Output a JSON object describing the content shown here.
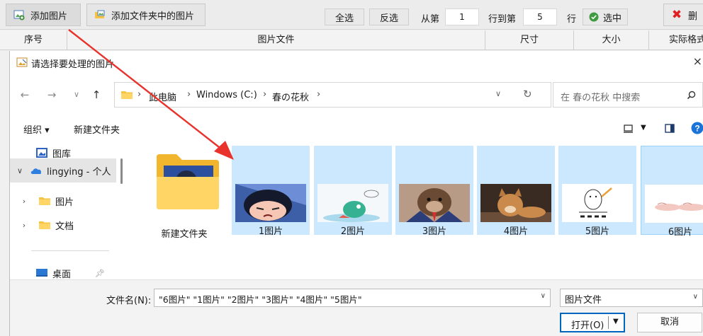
{
  "toolbar": {
    "add_image": "添加图片",
    "add_folder_images": "添加文件夹中的图片",
    "select_all": "全选",
    "invert": "反选",
    "from_label": "从第",
    "from_value": "1",
    "to_label": "行到第",
    "to_value": "5",
    "row_label": "行",
    "select_label": "选中",
    "delete_label": "删"
  },
  "table": {
    "columns": [
      "序号",
      "图片文件",
      "尺寸",
      "大小",
      "实际格式"
    ]
  },
  "dialog": {
    "title": "请选择要处理的图片",
    "close_glyph": "×",
    "breadcrumb": [
      "此电脑",
      "Windows (C:)",
      "春の花秋"
    ],
    "search_placeholder": "在 春の花秋 中搜索",
    "organize_label": "组织 ▾",
    "new_folder_cmd": "新建文件夹",
    "nav_items": [
      {
        "label": "图库"
      },
      {
        "label": "lingying - 个人"
      },
      {
        "label": "图片"
      },
      {
        "label": "文档"
      },
      {
        "label": "桌面"
      }
    ],
    "files": [
      {
        "label": "新建文件夹",
        "selected": false
      },
      {
        "label": "1图片",
        "selected": true
      },
      {
        "label": "2图片",
        "selected": true
      },
      {
        "label": "3图片",
        "selected": true
      },
      {
        "label": "4图片",
        "selected": true
      },
      {
        "label": "5图片",
        "selected": true
      },
      {
        "label": "6图片",
        "selected": true
      }
    ],
    "filename_label": "文件名(N):",
    "filename_value": "\"6图片\" \"1图片\" \"2图片\" \"3图片\" \"4图片\" \"5图片\"",
    "filetype_value": "图片文件",
    "open_label": "打开(O)",
    "cancel_label": "取消"
  },
  "colors": {
    "selection": "#cce8ff",
    "accent": "#0067c0",
    "folder": "#f6c342",
    "arrow": "#e8322b"
  }
}
